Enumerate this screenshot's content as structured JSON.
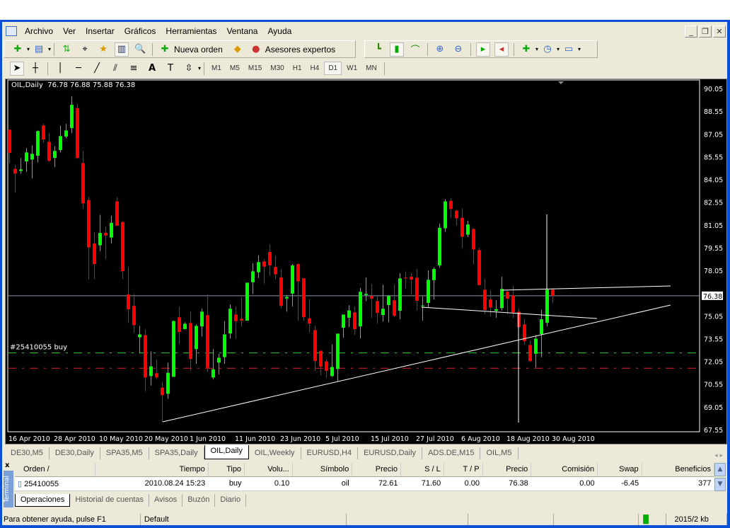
{
  "menu": [
    "Archivo",
    "Ver",
    "Insertar",
    "Gráficos",
    "Herramientas",
    "Ventana",
    "Ayuda"
  ],
  "toolbar": {
    "new_order": "Nueva orden",
    "experts": "Asesores expertos"
  },
  "timeframes": [
    "M1",
    "M5",
    "M15",
    "M30",
    "H1",
    "H4",
    "D1",
    "W1",
    "MN"
  ],
  "active_timeframe": "D1",
  "chart_data": {
    "type": "candlestick",
    "title": "OIL,Daily",
    "ohlc_header": "76.78 76.88 75.88 76.38",
    "ylim": [
      67.55,
      90.05
    ],
    "y_ticks": [
      "90.05",
      "88.55",
      "87.05",
      "85.55",
      "84.05",
      "82.55",
      "81.05",
      "79.55",
      "78.05",
      "75.05",
      "73.55",
      "72.05",
      "70.55",
      "69.05",
      "67.55"
    ],
    "current_price": "76.38",
    "x_ticks": [
      "16 Apr 2010",
      "28 Apr 2010",
      "10 May 2010",
      "20 May 2010",
      "1 Jun 2010",
      "11 Jun 2010",
      "23 Jun 2010",
      "5 Jul 2010",
      "15 Jul 2010",
      "27 Jul 2010",
      "6 Aug 2010",
      "18 Aug 2010",
      "30 Aug 2010"
    ],
    "order_label": "#25410055 buy",
    "order_price": 72.61,
    "stop_loss": 71.6,
    "colors": {
      "up": "#00ff00",
      "down": "#ff0000",
      "bg": "#000000",
      "grid": "#ffffff",
      "bid": "#8899aa"
    },
    "candles": [
      [
        87.33,
        87.33,
        85.1,
        85.8
      ],
      [
        84.75,
        85.02,
        83.18,
        84.44
      ],
      [
        84.61,
        85.46,
        84.43,
        84.71
      ],
      [
        85.24,
        86.11,
        84.55,
        85.83
      ],
      [
        85.36,
        86.3,
        84.11,
        85.74
      ],
      [
        85.61,
        87.28,
        85.17,
        87.24
      ],
      [
        87.61,
        87.72,
        86.46,
        86.69
      ],
      [
        86.53,
        87.13,
        85.22,
        85.28
      ],
      [
        85.47,
        86.24,
        84.86,
        85.93
      ],
      [
        85.99,
        87.6,
        85.83,
        86.91
      ],
      [
        86.88,
        87.71,
        86.77,
        87.28
      ],
      [
        87.44,
        89.55,
        87.1,
        88.97
      ],
      [
        88.75,
        89.03,
        85.41,
        85.46
      ],
      [
        85.13,
        85.93,
        82.1,
        82.47
      ],
      [
        82.69,
        82.91,
        77.44,
        79.57
      ],
      [
        79.83,
        80.58,
        77.49,
        78.47
      ],
      [
        79.71,
        81.72,
        79.32,
        80.52
      ],
      [
        80.53,
        80.96,
        78.8,
        80.35
      ],
      [
        80.22,
        81.66,
        79.83,
        81.19
      ],
      [
        82.6,
        82.88,
        81.0,
        81.0
      ],
      [
        81.24,
        81.3,
        77.49,
        78.0
      ],
      [
        76.47,
        78.3,
        74.63,
        75.49
      ],
      [
        75.71,
        76.5,
        73.93,
        74.44
      ],
      [
        73.64,
        74.39,
        72.6,
        73.83
      ],
      [
        73.78,
        74.16,
        70.08,
        70.99
      ],
      [
        71.08,
        72.71,
        70.46,
        71.72
      ],
      [
        71.27,
        72.16,
        70.88,
        70.99
      ],
      [
        70.32,
        70.69,
        68.05,
        69.82
      ],
      [
        69.91,
        71.97,
        69.58,
        71.3
      ],
      [
        71.03,
        74.74,
        71.03,
        74.71
      ],
      [
        74.96,
        75.68,
        73.19,
        73.99
      ],
      [
        74.18,
        74.63,
        74.18,
        74.53
      ],
      [
        74.58,
        75.33,
        71.43,
        72.21
      ],
      [
        72.86,
        74.49,
        71.89,
        74.39
      ],
      [
        74.36,
        75.53,
        73.69,
        75.33
      ],
      [
        75.1,
        76.47,
        71.36,
        71.63
      ],
      [
        70.99,
        72.86,
        70.85,
        71.53
      ],
      [
        71.97,
        72.55,
        71.19,
        72.29
      ],
      [
        72.33,
        74.71,
        71.89,
        73.83
      ],
      [
        73.89,
        75.8,
        73.55,
        75.52
      ],
      [
        75.14,
        75.68,
        73.52,
        74.71
      ],
      [
        74.86,
        76.27,
        74.36,
        74.74
      ],
      [
        74.74,
        77.24,
        74.74,
        77.24
      ],
      [
        77.27,
        78.52,
        76.5,
        77.99
      ],
      [
        77.93,
        79.05,
        77.55,
        78.6
      ],
      [
        78.64,
        78.8,
        77.18,
        78.3
      ],
      [
        79.27,
        79.78,
        77.71,
        78.38
      ],
      [
        78.28,
        79.03,
        77.44,
        77.8
      ],
      [
        77.58,
        78.11,
        75.57,
        75.72
      ],
      [
        76.2,
        76.43,
        75.33,
        76.3
      ],
      [
        76.52,
        78.46,
        75.68,
        78.38
      ],
      [
        78.47,
        78.52,
        74.74,
        77.33
      ],
      [
        77.53,
        77.53,
        74.74,
        74.97
      ],
      [
        74.89,
        76.14,
        73.96,
        74.55
      ],
      [
        74.11,
        74.39,
        71.43,
        72.08
      ],
      [
        72.75,
        72.75,
        71.14,
        71.71
      ],
      [
        72.05,
        72.18,
        70.96,
        71.43
      ],
      [
        71.08,
        73.18,
        71.03,
        71.68
      ],
      [
        71.55,
        73.88,
        70.75,
        73.88
      ],
      [
        74.27,
        75.14,
        73.61,
        75.14
      ],
      [
        74.93,
        75.75,
        74.32,
        75.41
      ],
      [
        75.28,
        75.68,
        73.8,
        74.18
      ],
      [
        74.36,
        76.89,
        73.57,
        76.64
      ],
      [
        76.42,
        77.58,
        76.02,
        76.5
      ],
      [
        76.36,
        77.16,
        74.93,
        76.19
      ],
      [
        76.03,
        76.42,
        74.55,
        75.25
      ],
      [
        75.11,
        77.11,
        74.67,
        75.52
      ],
      [
        75.77,
        76.42,
        74.63,
        76.36
      ],
      [
        76.08,
        77.11,
        74.99,
        75.06
      ],
      [
        75.39,
        77.86,
        74.83,
        77.52
      ],
      [
        77.58,
        77.99,
        76.85,
        77.53
      ],
      [
        77.63,
        77.86,
        76.46,
        77.44
      ],
      [
        77.57,
        78.14,
        75.39,
        76.05
      ],
      [
        75.69,
        76.33,
        74.74,
        75.74
      ],
      [
        75.91,
        78.05,
        75.57,
        77.43
      ],
      [
        77.41,
        78.25,
        76.14,
        78.14
      ],
      [
        78.38,
        81.14,
        78.22,
        80.86
      ],
      [
        80.83,
        82.75,
        80.6,
        82.6
      ],
      [
        82.64,
        82.83,
        81.53,
        82.1
      ],
      [
        81.99,
        82.05,
        80.99,
        81.49
      ],
      [
        81.52,
        82.13,
        79.52,
        80.27
      ],
      [
        80.41,
        81.33,
        80.25,
        81.08
      ],
      [
        80.78,
        80.83,
        78.46,
        79.43
      ],
      [
        79.39,
        79.55,
        77.08,
        77.08
      ],
      [
        76.78,
        77.49,
        75.17,
        75.44
      ],
      [
        76.13,
        76.74,
        75.02,
        75.61
      ],
      [
        75.38,
        76.08,
        74.93,
        75.49
      ],
      [
        75.57,
        77.63,
        75.41,
        76.83
      ],
      [
        76.64,
        76.77,
        75.17,
        76.19
      ],
      [
        76.41,
        77.05,
        74.93,
        75.28
      ],
      [
        75.33,
        75.57,
        74.24,
        74.32
      ],
      [
        74.49,
        74.83,
        73.14,
        73.38
      ],
      [
        73.13,
        73.42,
        72.02,
        72.07
      ],
      [
        72.55,
        73.77,
        71.64,
        73.55
      ],
      [
        73.85,
        75.46,
        72.33,
        74.83
      ],
      [
        74.6,
        76.82,
        74.36,
        76.78
      ],
      [
        76.78,
        76.88,
        75.88,
        76.38
      ]
    ]
  },
  "chart_tabs": [
    "DE30,M5",
    "DE30,Daily",
    "SPA35,M5",
    "SPA35,Daily",
    "OIL,Daily",
    "OIL,Weekly",
    "EURUSD,H4",
    "EURUSD,Daily",
    "ADS.DE,M15",
    "OIL,M5"
  ],
  "active_chart_tab": "OIL,Daily",
  "terminal": {
    "side_label": "Terminal",
    "columns": [
      "Orden  /",
      "Tiempo",
      "Tipo",
      "Volu...",
      "Símbolo",
      "Precio",
      "S / L",
      "T / P",
      "Precio",
      "Comisión",
      "Swap",
      "Beneficios"
    ],
    "rows": [
      [
        "25410055",
        "2010.08.24 15:23",
        "buy",
        "0.10",
        "oil",
        "72.61",
        "71.60",
        "0.00",
        "76.38",
        "0.00",
        "-6.45",
        "377"
      ]
    ],
    "tabs": [
      "Operaciones",
      "Historial de cuentas",
      "Avisos",
      "Buzón",
      "Diario"
    ]
  },
  "status": {
    "help": "Para obtener ayuda, pulse F1",
    "profile": "Default",
    "traffic": "2015/2 kb"
  }
}
